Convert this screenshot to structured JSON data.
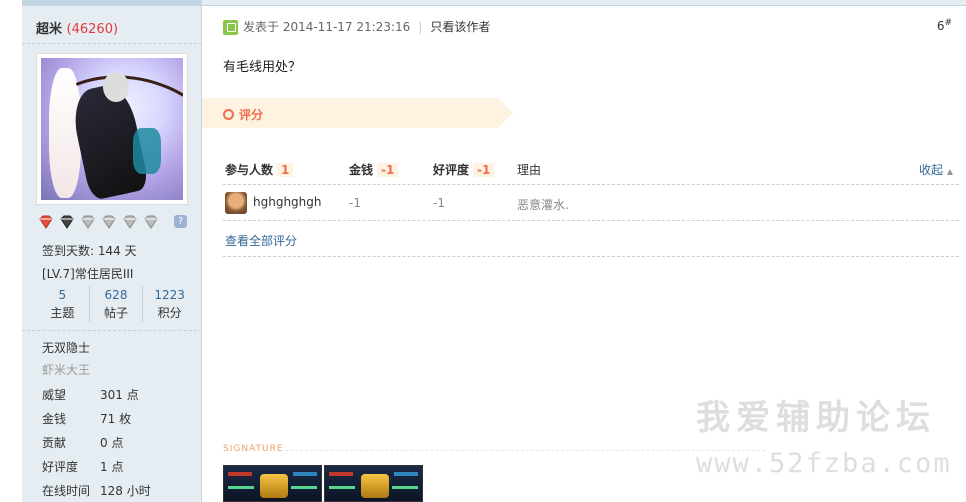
{
  "user": {
    "name": "超米",
    "uid": "(46260)",
    "checkin": "签到天数: 144 天",
    "level": "[LV.7]常住居民III",
    "stats": [
      {
        "num": "5",
        "label": "主题"
      },
      {
        "num": "628",
        "label": "帖子"
      },
      {
        "num": "1223",
        "label": "积分"
      }
    ],
    "group1": "无双隐士",
    "group2": "虾米大王",
    "fields": [
      {
        "k": "威望",
        "v": "301 点"
      },
      {
        "k": "金钱",
        "v": "71 枚"
      },
      {
        "k": "贡献",
        "v": "0 点"
      },
      {
        "k": "好评度",
        "v": "1 点"
      },
      {
        "k": "在线时间",
        "v": "128 小时"
      }
    ],
    "medal_help": "?"
  },
  "post": {
    "posted": "发表于 2014-11-17 21:23:16",
    "only_author": "只看该作者",
    "floor": "6",
    "floor_sup": "#",
    "message": "有毛线用处？"
  },
  "rating": {
    "title": "评分",
    "head": {
      "participants": "参与人数",
      "participants_count": "1",
      "money": "金钱",
      "money_val": "-1",
      "reputation": "好评度",
      "reputation_val": "-1",
      "reason": "理由",
      "collapse": "收起"
    },
    "rows": [
      {
        "user": "hghghghgh",
        "money": "-1",
        "reputation": "-1",
        "reason": "恶意灌水."
      }
    ],
    "view_all": "查看全部评分"
  },
  "signature_label": "SIGNATURE",
  "watermark": {
    "line1": "我爱辅助论坛",
    "line2": "www.52fzba.com"
  },
  "colors": {
    "sidebar_bg": "#e5edf2",
    "accent_orange": "#f26c4f",
    "link_blue": "#336699",
    "uid_red": "#e5393a"
  }
}
